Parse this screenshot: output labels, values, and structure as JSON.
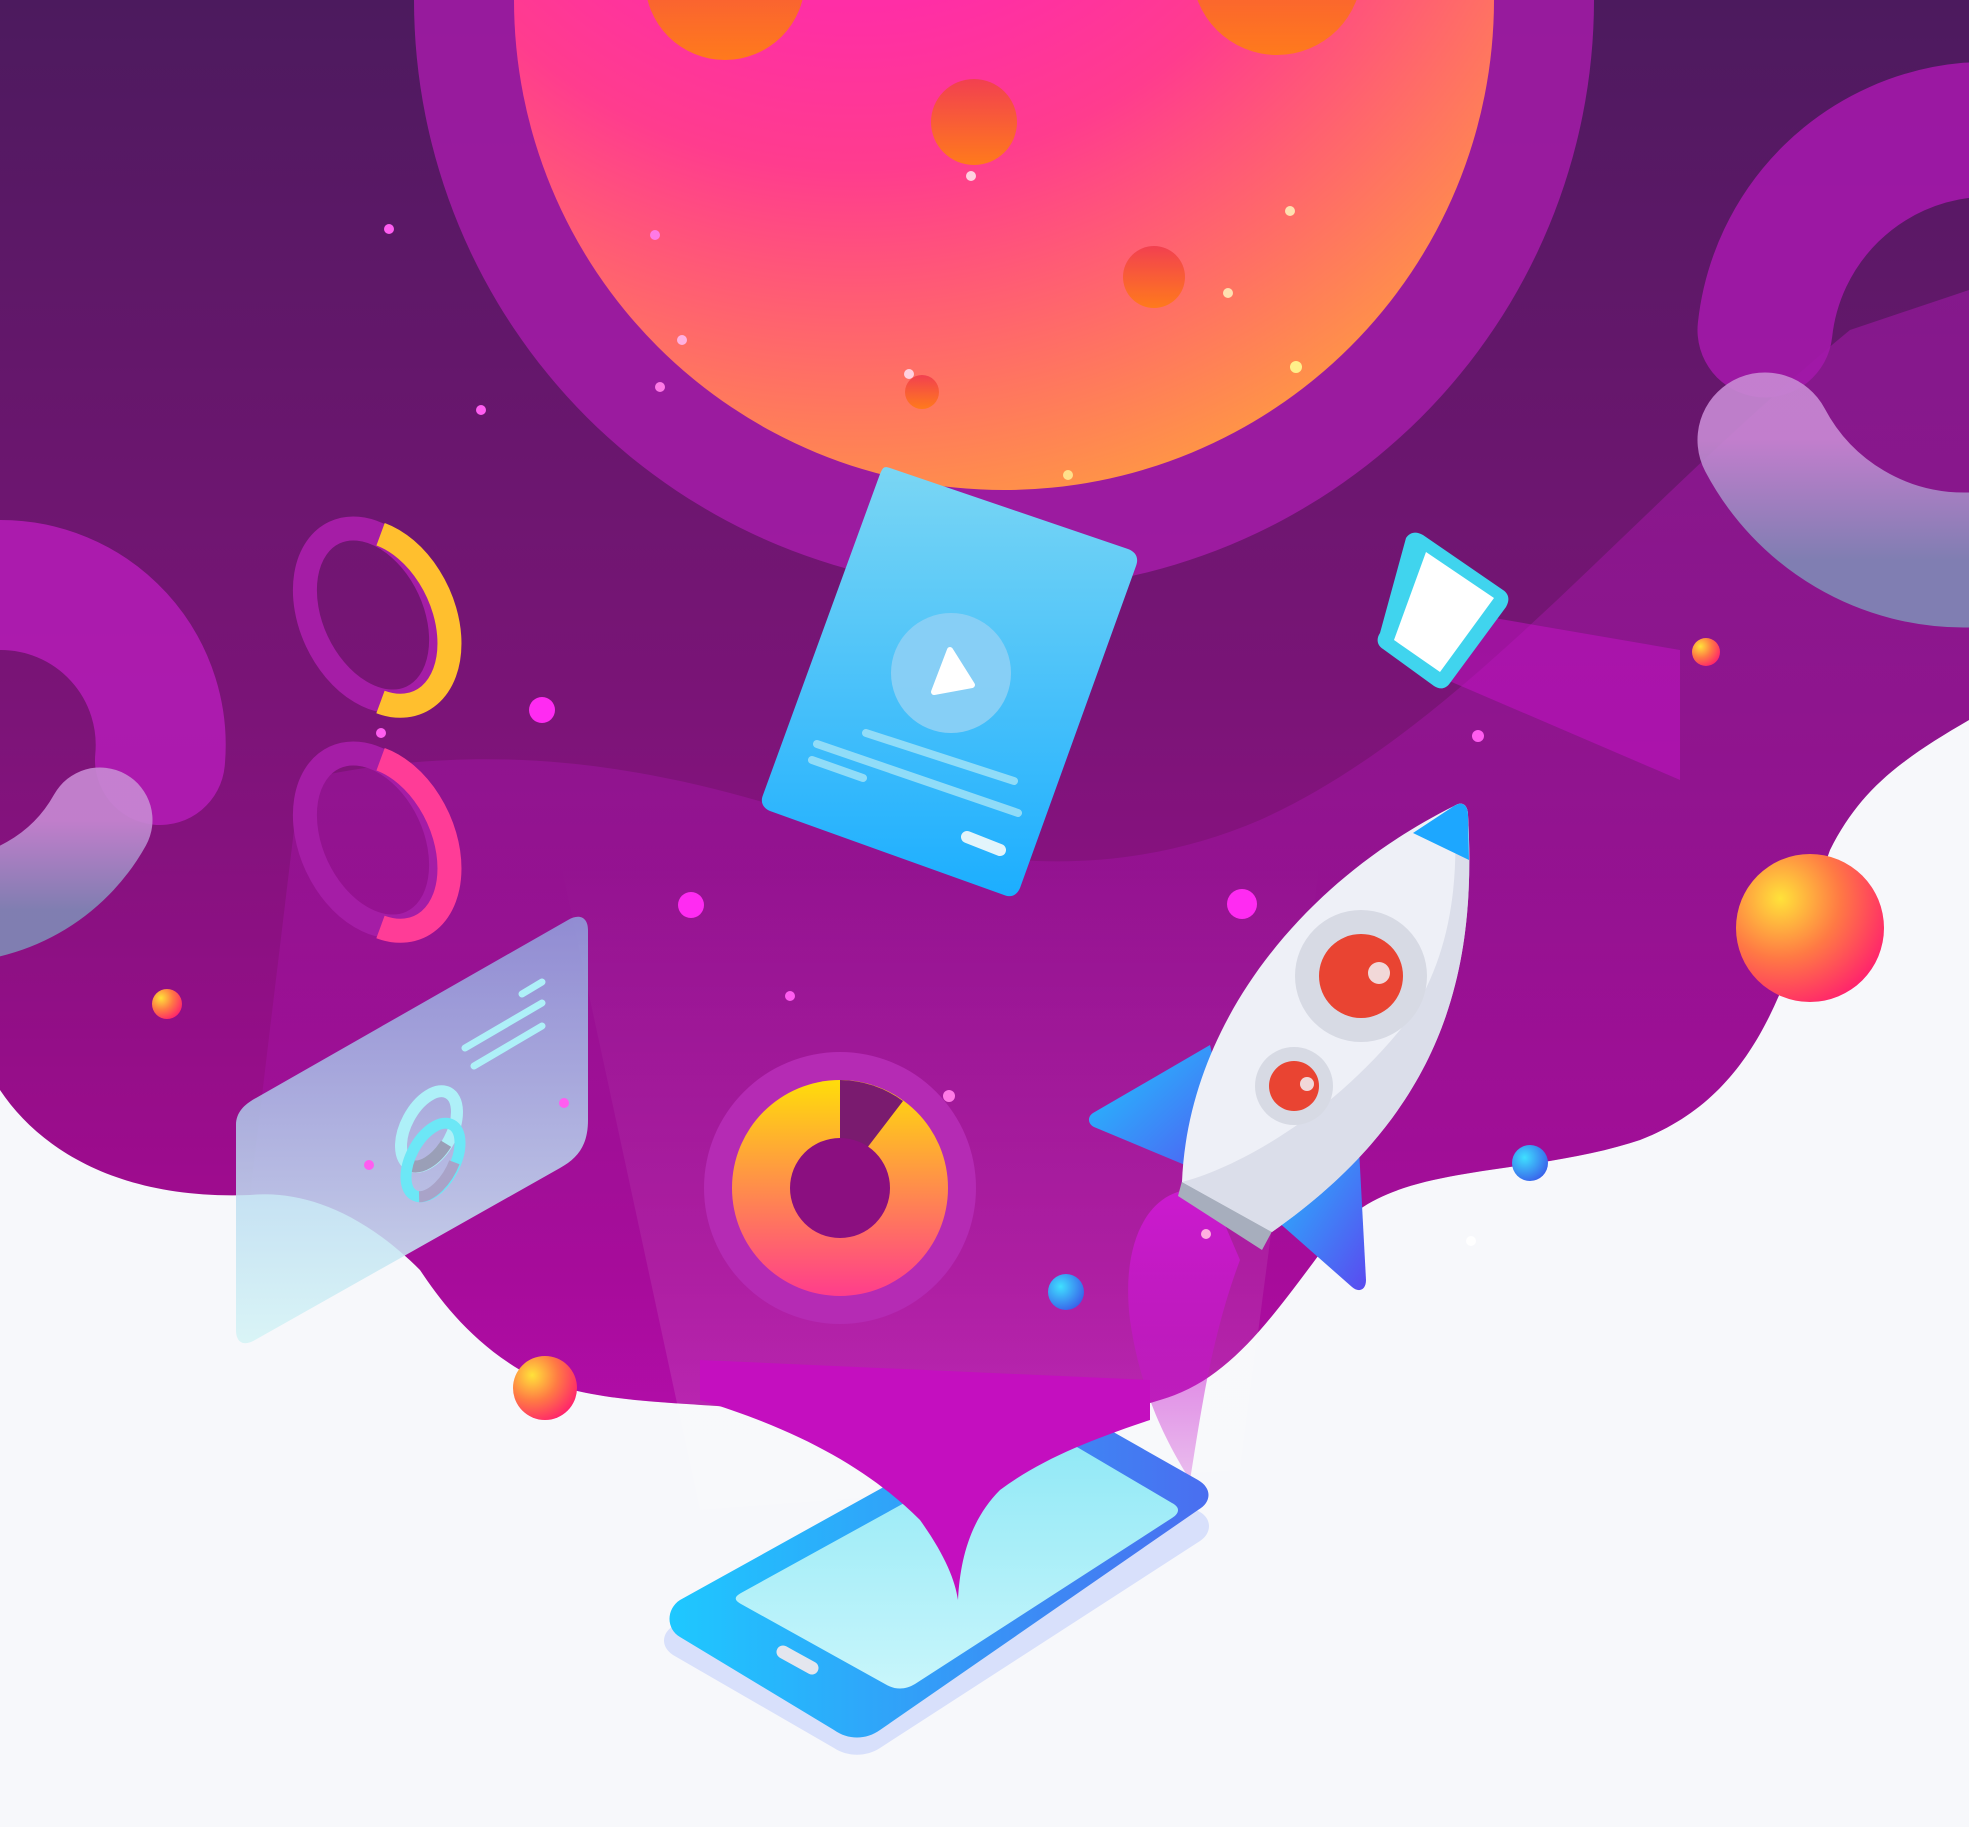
{
  "illustration": {
    "subject": "mobile-app-launch",
    "text_content": "",
    "colors": {
      "page_background": "#f7f8fb",
      "space_dark": "#4c1a5e",
      "space_mid": "#8e0e86",
      "space_magenta": "#c40fbf",
      "planet_pink": "#ff16c8",
      "planet_orange": "#ffa040",
      "accent_cyan": "#1ec8ff",
      "accent_blue": "#3b6cf0",
      "accent_yellow": "#ffcf2e",
      "rocket_body": "#eef0f7",
      "rocket_window_red": "#e94432"
    },
    "icons": {
      "planet": "large-planet-icon",
      "rocket": "rocket-icon",
      "phone": "smartphone-icon",
      "video_card": "video-card-icon",
      "play": "play-icon",
      "donut_chart": "donut-chart-icon",
      "small_phone": "small-phone-icon",
      "glass_panel": "glass-dashboard-panel-icon",
      "ring": "progress-ring-icon",
      "orb": "orb-icon"
    },
    "donut_chart_fill_fraction": 0.88,
    "left_ring_fill_fractions": [
      0.35,
      0.2
    ]
  }
}
